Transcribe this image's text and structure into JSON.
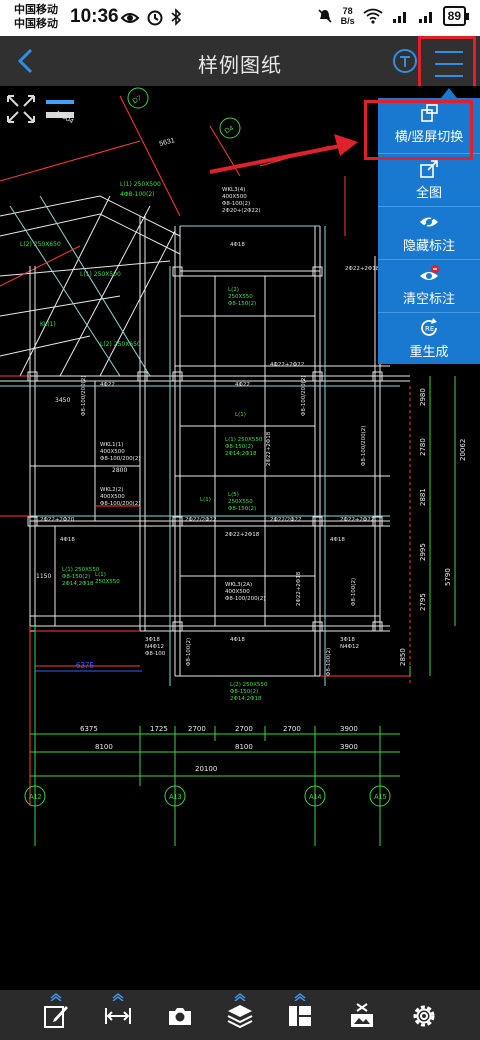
{
  "status_bar": {
    "carrier1": "中国移动",
    "carrier2": "中国移动",
    "time": "10:36",
    "net_speed_value": "78",
    "net_speed_unit": "B/s",
    "battery": "89"
  },
  "app_bar": {
    "title": "样例图纸",
    "back_icon": "back-chevron-icon",
    "text_tool_icon": "text-tool-icon",
    "menu_icon": "hamburger-menu-icon"
  },
  "popup_menu": {
    "items": [
      {
        "label": "横/竖屏切换",
        "icon": "rotate-screen-icon"
      },
      {
        "label": "全图",
        "icon": "full-view-icon"
      },
      {
        "label": "隐藏标注",
        "icon": "hide-eye-icon"
      },
      {
        "label": "清空标注",
        "icon": "clear-eye-icon"
      },
      {
        "label": "重生成",
        "icon": "regenerate-icon"
      }
    ]
  },
  "drawing": {
    "dims_row1": [
      "6375",
      "1725",
      "2700",
      "2700",
      "2700",
      "3900"
    ],
    "dims_row2": [
      "8100",
      "8100",
      "3900"
    ],
    "dim_total": "20100",
    "dim_blue": "6375",
    "dim_top": "5631",
    "dims_right": [
      "2980",
      "2780",
      "2881",
      "2995",
      "2795",
      "2850"
    ],
    "dims_right_outer": [
      "20062",
      "5790"
    ],
    "grid_bubbles": [
      "A12",
      "A13",
      "A14",
      "A15"
    ],
    "top_bubbles": [
      "D7",
      "D4"
    ],
    "misc_label": "2800",
    "misc_label2": "3450",
    "misc_label3": "1150",
    "colors": {
      "line_white": "#e9e9e9",
      "line_cyan": "#8fd3d3",
      "line_green": "#3fd23f",
      "line_red": "#ff3b3b",
      "text_green": "#3ee04a",
      "dim_blue": "#3a5cff"
    }
  },
  "toolbar": {
    "buttons": [
      {
        "icon": "annotate-pen-icon"
      },
      {
        "icon": "measure-distance-icon"
      },
      {
        "icon": "camera-icon"
      },
      {
        "icon": "layers-icon"
      },
      {
        "icon": "layout-panel-icon"
      },
      {
        "icon": "export-image-icon"
      },
      {
        "icon": "settings-gear-icon"
      }
    ]
  }
}
